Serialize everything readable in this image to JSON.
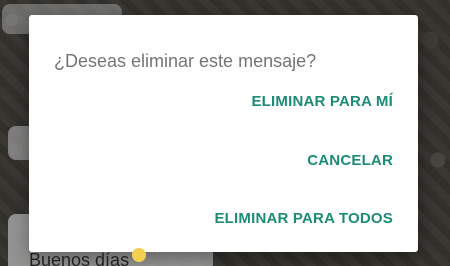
{
  "background": {
    "chat_message": "Buenos días"
  },
  "dialog": {
    "title": "¿Deseas eliminar este mensaje?",
    "actions": [
      {
        "label": "ELIMINAR PARA MÍ"
      },
      {
        "label": "CANCELAR"
      },
      {
        "label": "ELIMINAR PARA TODOS"
      }
    ]
  },
  "colors": {
    "dialog_background": "#ffffff",
    "title_text": "#757575",
    "action_text": "#1c8c77",
    "scrim": "rgba(0,0,0,0.35)"
  }
}
